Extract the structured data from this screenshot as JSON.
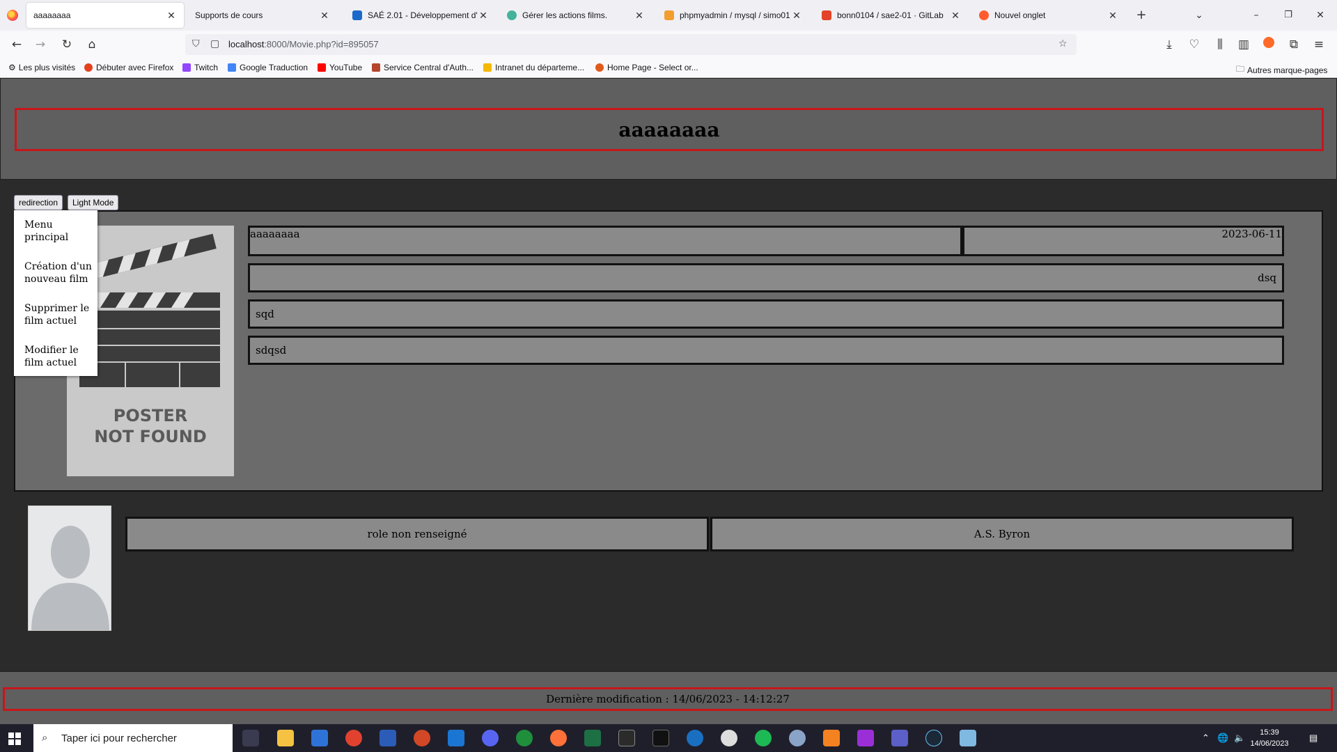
{
  "browser": {
    "tabs": [
      {
        "label": "aaaaaaaa",
        "active": true,
        "color": "#ffffff"
      },
      {
        "label": "Supports de cours",
        "active": false,
        "color": "#ffffff"
      },
      {
        "label": "SAÉ 2.01 - Développement d'un",
        "active": false,
        "color": "#1b6ac9"
      },
      {
        "label": "Gérer les actions films.",
        "active": false,
        "color": "#44b39a"
      },
      {
        "label": "phpmyadmin / mysql / simo01",
        "active": false,
        "color": "#f29e2e"
      },
      {
        "label": "bonn0104 / sae2-01 · GitLab",
        "active": false,
        "color": "#e24329"
      },
      {
        "label": "Nouvel onglet",
        "active": false,
        "color": "#ff5b2e"
      }
    ],
    "url_host": "localhost",
    "url_rest": ":8000/Movie.php?id=895057",
    "bookmarks": [
      {
        "label": "Les plus visités",
        "color": "#555555"
      },
      {
        "label": "Débuter avec Firefox",
        "color": "#e3421d"
      },
      {
        "label": "Twitch",
        "color": "#9146ff"
      },
      {
        "label": "Google Traduction",
        "color": "#4285f4"
      },
      {
        "label": "YouTube",
        "color": "#ff0000"
      },
      {
        "label": "Service Central d'Auth...",
        "color": "#b5452b"
      },
      {
        "label": "Intranet du départeme...",
        "color": "#f5b800"
      },
      {
        "label": "Home Page - Select or...",
        "color": "#e05a1d"
      }
    ],
    "other_bookmarks": "Autres marque-pages"
  },
  "page": {
    "title": "aaaaaaaa",
    "redirect_button": "redirection",
    "mode_button": "Light Mode",
    "menu_items": [
      "Menu principal",
      "Création d'un nouveau film",
      "Supprimer le film actuel",
      "Modifier le film actuel"
    ],
    "poster_text_line1": "POSTER",
    "poster_text_line2": "NOT FOUND",
    "movie": {
      "title": "aaaaaaaa",
      "release_date": "2023-06-11",
      "field2": "dsq",
      "field3": "sqd",
      "field4": "sdqsd"
    },
    "cast": {
      "role": "role non renseigné",
      "actor": "A.S. Byron"
    },
    "footer": "Dernière modification : 14/06/2023 - 14:12:27"
  },
  "taskbar": {
    "search_placeholder": "Taper ici pour rechercher",
    "time": "15:39",
    "date": "14/06/2023"
  },
  "colors": {
    "accent_border": "#c8161b",
    "page_bg": "#2b2b2b",
    "panel_bg": "#6b6b6b",
    "field_bg": "#8a8a8a"
  }
}
